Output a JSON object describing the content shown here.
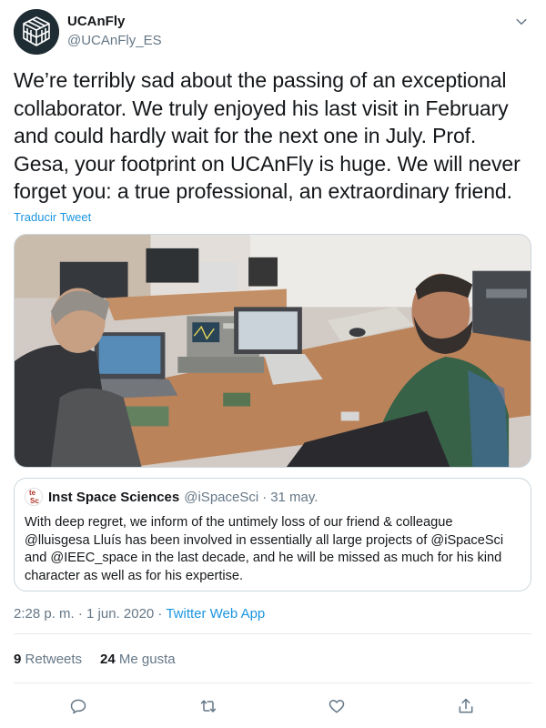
{
  "header": {
    "display_name": "UCAnFly",
    "handle": "@UCAnFly_ES",
    "avatar_icon": "cube-logo-icon",
    "menu_icon": "chevron-down-icon"
  },
  "tweet": {
    "text": "We’re terribly sad about the passing of an exceptional collaborator. We truly enjoyed his last visit in February and could hardly wait for the next one in July. Prof. Gesa, your footprint on UCAnFly is huge. We will never forget you: a true professional, an extraordinary friend.",
    "translate_label": "Traducir Tweet"
  },
  "quote": {
    "avatar_text_1": "te",
    "avatar_text_2": "Sc",
    "name": "Inst Space Sciences",
    "handle": "@iSpaceSci",
    "separator": "·",
    "date": "31 may.",
    "text": "With deep regret, we inform of the untimely loss of our friend & colleague @lluisgesa Lluís has been involved in essentially all large projects of @iSpaceSci and @IEEC_space in the last decade, and he will be missed as much for his kind character as well as for his expertise."
  },
  "meta": {
    "timestamp": "2:28 p. m. · 1 jun. 2020",
    "separator": " · ",
    "source": "Twitter Web App"
  },
  "stats": {
    "retweets_count": "9",
    "retweets_label": "Retweets",
    "likes_count": "24",
    "likes_label": "Me gusta"
  },
  "actions": {
    "reply_icon": "reply-icon",
    "retweet_icon": "retweet-icon",
    "like_icon": "heart-icon",
    "share_icon": "share-icon"
  },
  "colors": {
    "link": "#1b95e0",
    "secondary": "#657786",
    "border": "#ccd6dd"
  }
}
